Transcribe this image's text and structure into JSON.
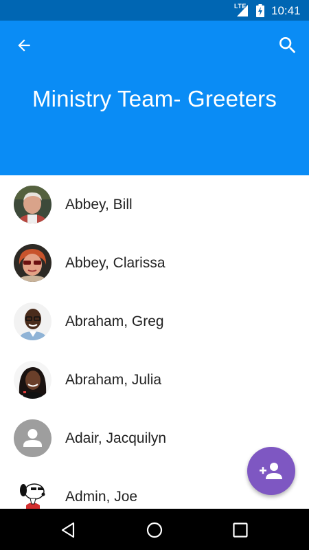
{
  "status_bar": {
    "network": "LTE",
    "time": "10:41",
    "icons": [
      "signal-icon",
      "battery-charging-icon"
    ]
  },
  "app_bar": {
    "title": "Ministry Team- Greeters",
    "back_icon": "arrow-back-icon",
    "search_icon": "search-icon"
  },
  "contacts": [
    {
      "name": "Abbey, Bill",
      "avatar": "photo"
    },
    {
      "name": "Abbey, Clarissa",
      "avatar": "photo"
    },
    {
      "name": "Abraham, Greg",
      "avatar": "photo"
    },
    {
      "name": "Abraham, Julia",
      "avatar": "photo"
    },
    {
      "name": "Adair, Jacquilyn",
      "avatar": "default-person"
    },
    {
      "name": "Admin, Joe",
      "avatar": "cartoon"
    }
  ],
  "fab": {
    "icon": "add-person-icon",
    "color": "#7e57c2"
  },
  "nav_bar": {
    "icons": [
      "nav-back-icon",
      "nav-home-icon",
      "nav-recents-icon"
    ]
  },
  "colors": {
    "status_bar": "#0066b3",
    "app_bar": "#0a8cf5",
    "fab": "#7e57c2"
  }
}
